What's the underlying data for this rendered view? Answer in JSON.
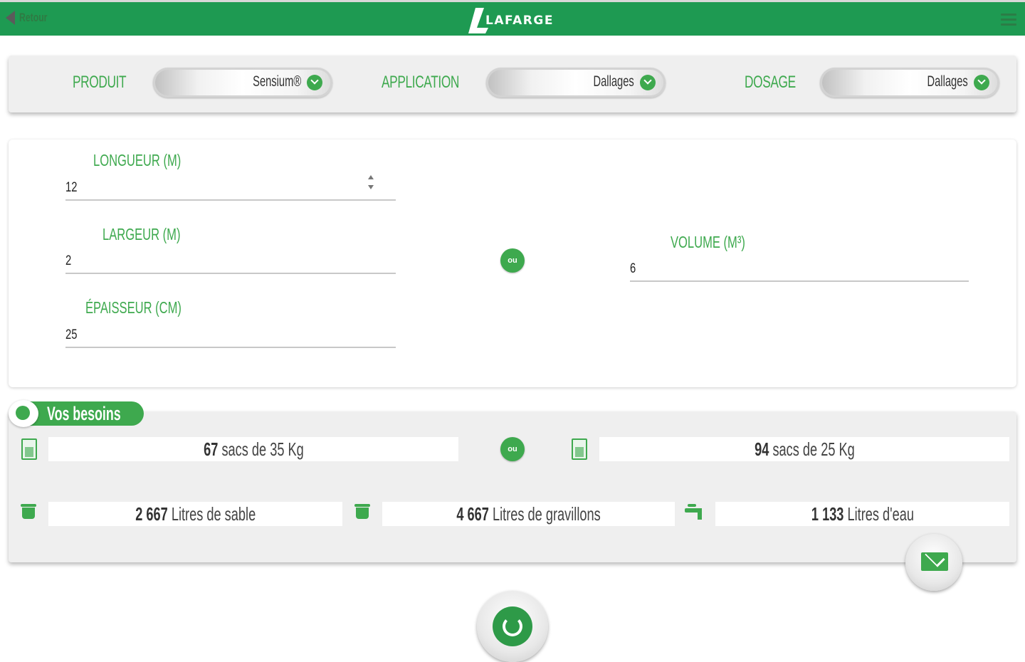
{
  "header": {
    "back_label": "Retour",
    "brand": "LAFARGE"
  },
  "selectors": {
    "produit": {
      "label": "PRODUIT",
      "value": "Sensium®"
    },
    "application": {
      "label": "APPLICATION",
      "value": "Dallages"
    },
    "dosage": {
      "label": "DOSAGE",
      "value": "Dallages"
    }
  },
  "dimensions": {
    "longueur": {
      "label": "LONGUEUR (M)",
      "value": "12"
    },
    "largeur": {
      "label": "LARGEUR (M)",
      "value": "2"
    },
    "epaisseur": {
      "label": "ÉPAISSEUR (CM)",
      "value": "25"
    },
    "or_label": "ou",
    "volume": {
      "label": "VOLUME (M³)",
      "value": "6"
    }
  },
  "results": {
    "title": "Vos besoins",
    "or_label": "ou",
    "bags_35": {
      "number": "67",
      "text": " sacs de 35 Kg"
    },
    "bags_25": {
      "number": "94",
      "text": " sacs de 25 Kg"
    },
    "sable": {
      "number": "2 667",
      "text": " Litres de sable"
    },
    "gravillons": {
      "number": "4 667",
      "text": " Litres de gravillons"
    },
    "eau": {
      "number": "1 133",
      "text": " Litres d'eau"
    }
  },
  "colors": {
    "brand_green": "#1e9a52",
    "accent_green": "#3ea94e"
  },
  "icons": [
    "back-arrow-icon",
    "lafarge-logo",
    "hamburger-menu-icon",
    "chevron-down-icon",
    "bag-icon",
    "bucket-icon",
    "water-tap-icon",
    "mail-icon",
    "refresh-icon",
    "search-icon"
  ]
}
